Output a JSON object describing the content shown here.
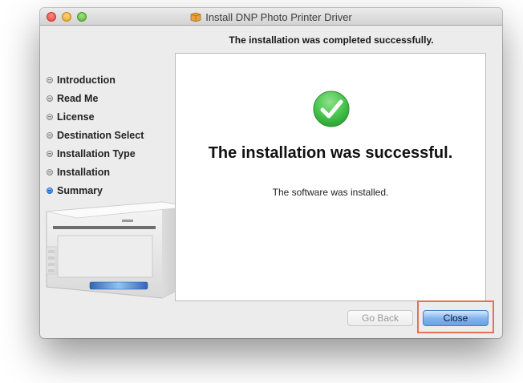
{
  "window": {
    "title": "Install DNP Photo Printer Driver",
    "title_icon": "package-icon"
  },
  "heading": "The installation was completed successfully.",
  "steps": [
    {
      "label": "Introduction",
      "active": false
    },
    {
      "label": "Read Me",
      "active": false
    },
    {
      "label": "License",
      "active": false
    },
    {
      "label": "Destination Select",
      "active": false
    },
    {
      "label": "Installation Type",
      "active": false
    },
    {
      "label": "Installation",
      "active": false
    },
    {
      "label": "Summary",
      "active": true
    }
  ],
  "content": {
    "icon": "success-check-icon",
    "title": "The installation was successful.",
    "message": "The software was installed."
  },
  "buttons": {
    "back_label": "Go Back",
    "close_label": "Close"
  },
  "colors": {
    "success_green": "#43c24a",
    "active_step_blue": "#2f7ae0",
    "default_button_blue": "#6aa2e6",
    "highlight_red": "#e6705a"
  }
}
